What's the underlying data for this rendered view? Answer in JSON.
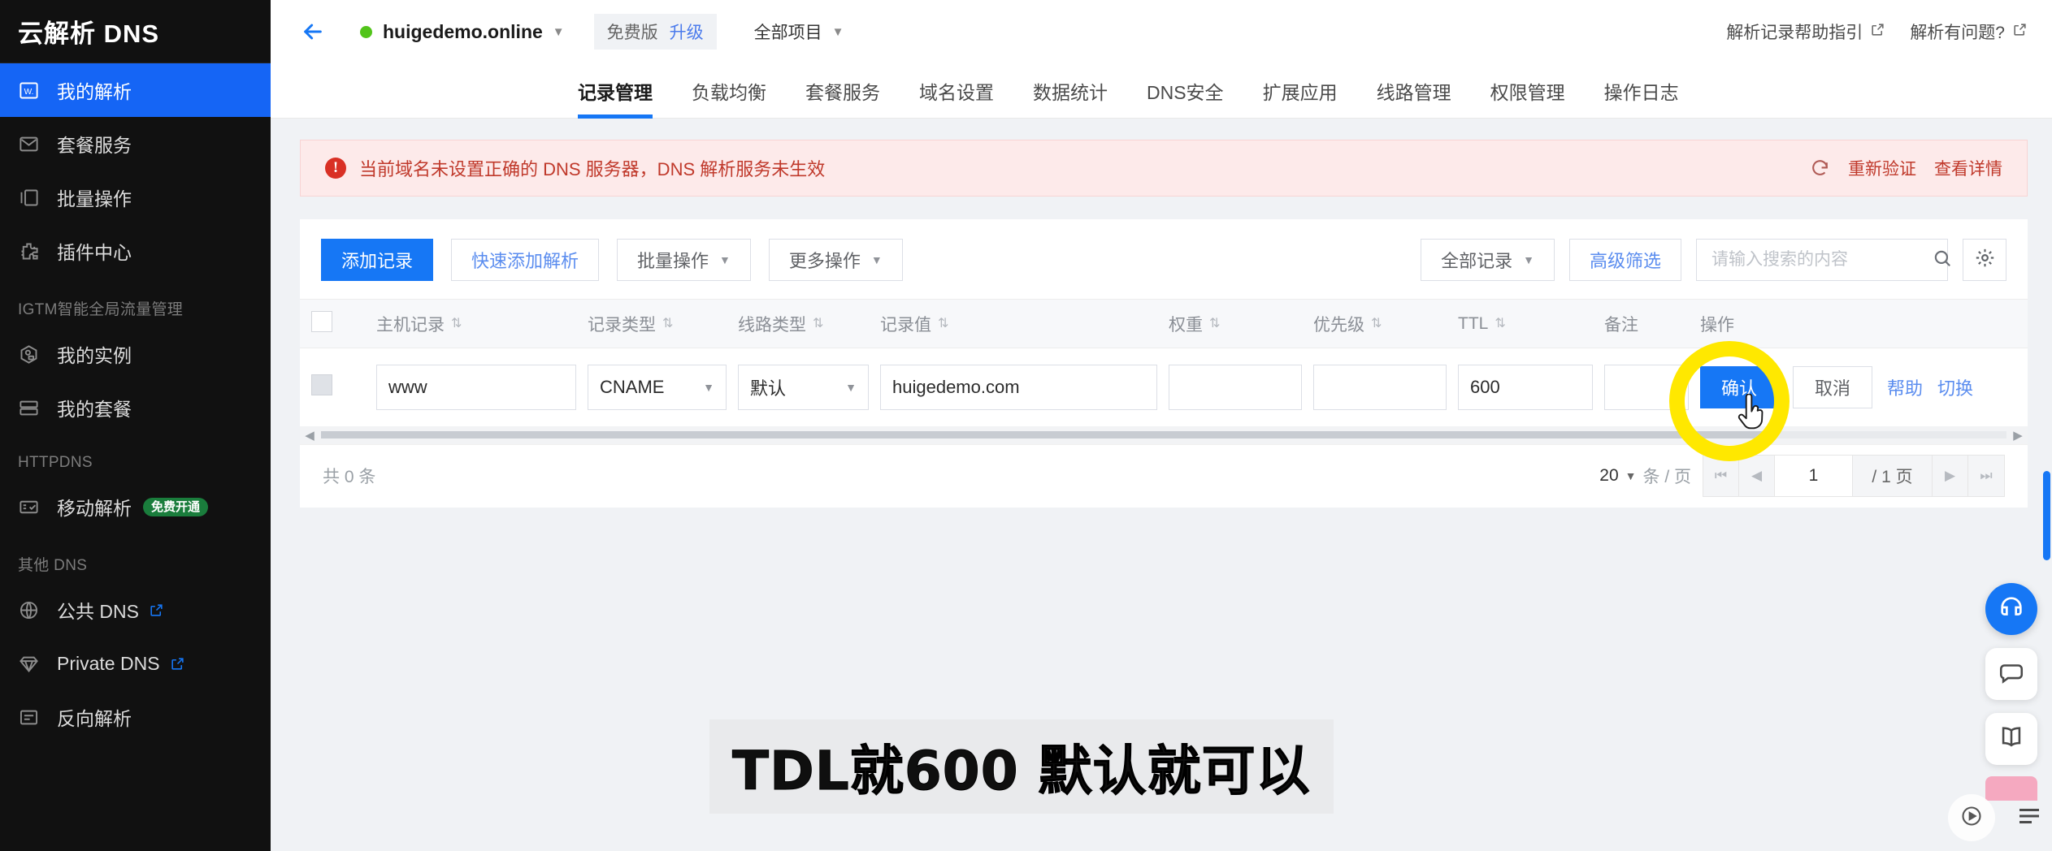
{
  "sidebar": {
    "brand": "云解析 DNS",
    "items": [
      {
        "label": "我的解析",
        "icon": "w-record-icon",
        "active": true
      },
      {
        "label": "套餐服务",
        "icon": "package-icon",
        "active": false
      },
      {
        "label": "批量操作",
        "icon": "batch-icon",
        "active": false
      },
      {
        "label": "插件中心",
        "icon": "plugin-icon",
        "active": false
      }
    ],
    "group_igtm": "IGTM智能全局流量管理",
    "igtm_items": [
      {
        "label": "我的实例",
        "icon": "instance-icon"
      },
      {
        "label": "我的套餐",
        "icon": "my-package-icon"
      }
    ],
    "group_httpdns": "HTTPDNS",
    "httpdns_items": [
      {
        "label": "移动解析",
        "icon": "mobile-resolve-icon",
        "badge": "免费开通"
      }
    ],
    "group_other": "其他 DNS",
    "other_items": [
      {
        "label": "公共 DNS",
        "icon": "globe-icon",
        "external": true
      },
      {
        "label": "Private DNS",
        "icon": "diamond-icon",
        "external": true
      },
      {
        "label": "反向解析",
        "icon": "reverse-icon",
        "external": false
      }
    ]
  },
  "topbar": {
    "back_icon": "back-arrow-icon",
    "status_dot_color": "#52c41a",
    "domain": "huigedemo.online",
    "domain_caret": "▼",
    "plan_label": "免费版",
    "plan_upgrade": "升级",
    "project_selector": "全部项目",
    "project_caret": "▼",
    "links": [
      {
        "label": "解析记录帮助指引",
        "icon": "external-link-icon"
      },
      {
        "label": "解析有问题?",
        "icon": "external-link-icon"
      }
    ]
  },
  "tabs": [
    {
      "label": "记录管理",
      "active": true
    },
    {
      "label": "负载均衡",
      "active": false
    },
    {
      "label": "套餐服务",
      "active": false
    },
    {
      "label": "域名设置",
      "active": false
    },
    {
      "label": "数据统计",
      "active": false
    },
    {
      "label": "DNS安全",
      "active": false
    },
    {
      "label": "扩展应用",
      "active": false
    },
    {
      "label": "线路管理",
      "active": false
    },
    {
      "label": "权限管理",
      "active": false
    },
    {
      "label": "操作日志",
      "active": false
    }
  ],
  "alert": {
    "icon": "error-info-icon",
    "message": "当前域名未设置正确的 DNS 服务器，DNS 解析服务未生效",
    "refresh_icon": "refresh-icon",
    "action_verify": "重新验证",
    "action_detail": "查看详情"
  },
  "toolbar": {
    "add_record": "添加记录",
    "quick_add": "快速添加解析",
    "batch_ops": "批量操作",
    "more_ops": "更多操作",
    "dropdown_caret": "▼",
    "record_filter": "全部记录",
    "advanced_filter": "高级筛选",
    "search_placeholder": "请输入搜索的内容",
    "search_value": "",
    "search_icon": "search-icon",
    "settings_icon": "gear-icon"
  },
  "table": {
    "columns": [
      {
        "label": "",
        "key": "checkbox",
        "sortable": false
      },
      {
        "label": "主机记录",
        "key": "host",
        "sortable": true
      },
      {
        "label": "记录类型",
        "key": "type",
        "sortable": true
      },
      {
        "label": "线路类型",
        "key": "line",
        "sortable": true
      },
      {
        "label": "记录值",
        "key": "value",
        "sortable": true
      },
      {
        "label": "权重",
        "key": "weight",
        "sortable": true
      },
      {
        "label": "优先级",
        "key": "priority",
        "sortable": true
      },
      {
        "label": "TTL",
        "key": "ttl",
        "sortable": true
      },
      {
        "label": "备注",
        "key": "note",
        "sortable": false
      },
      {
        "label": "操作",
        "key": "actions",
        "sortable": false
      }
    ],
    "sort_glyph": "⇅",
    "rows": [
      {
        "host": "www",
        "type": "CNAME",
        "line": "默认",
        "value": "huigedemo.com",
        "weight": "",
        "priority": "",
        "ttl": "600",
        "note": "",
        "actions": {
          "confirm": "确认",
          "cancel": "取消",
          "help": "帮助",
          "switch": "切换"
        }
      }
    ]
  },
  "pager": {
    "total_prefix": "共",
    "total_count": "0",
    "total_suffix": "条",
    "page_size": "20",
    "page_size_caret": "▼",
    "per_page_unit": "条 / 页",
    "first_glyph": "⏮",
    "prev_glyph": "◀",
    "current_page": "1",
    "total_pages": "/ 1 页",
    "next_glyph": "▶",
    "last_glyph": "⏭"
  },
  "overlay": {
    "caption": "TDL就600 默认就可以",
    "highlight_color": "#ffe800",
    "cursor_icon": "hand-pointer-icon"
  },
  "floating": {
    "chat_icon": "chat-support-icon",
    "feedback_icon": "feedback-icon",
    "docs_icon": "docs-icon",
    "play_icon": "play-icon",
    "playlist_icon": "playlist-icon"
  }
}
